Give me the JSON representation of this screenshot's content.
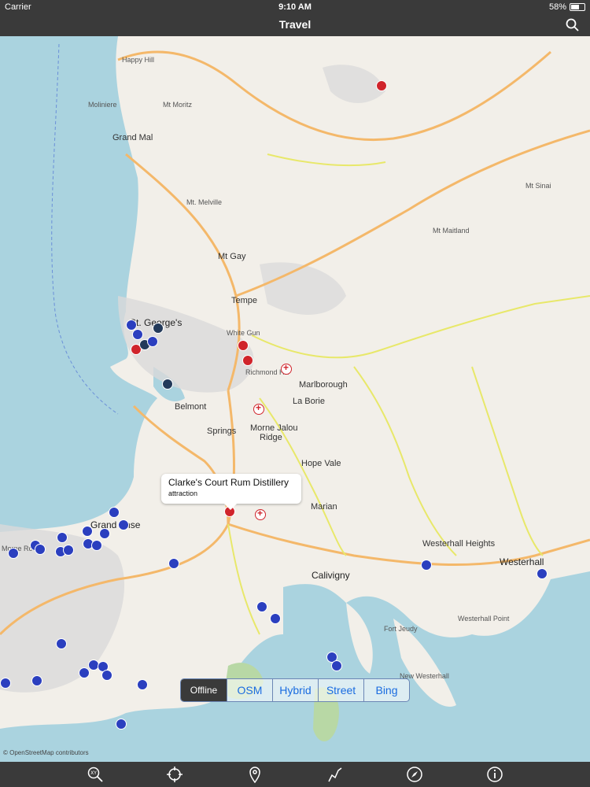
{
  "status_bar": {
    "carrier": "Carrier",
    "time": "9:10 AM",
    "battery": "58%"
  },
  "nav": {
    "title": "Travel"
  },
  "map": {
    "labels": {
      "happy_hill": "Happy Hill",
      "moliniere": "Moliniere",
      "mt_moritz": "Mt Moritz",
      "grand_mal": "Grand Mal",
      "mt_melville": "Mt. Melville",
      "mt_sinai": "Mt Sinai",
      "mt_maitland": "Mt Maitland",
      "mt_gay": "Mt Gay",
      "tempe": "Tempe",
      "st_georges": "St. George's",
      "marlborough": "Marlborough",
      "la_borie": "La Borie",
      "belmont": "Belmont",
      "springs": "Springs",
      "morne_jaloux_ridge_1": "Morne Jalou",
      "morne_jaloux_ridge_2": "Ridge",
      "hope_vale": "Hope Vale",
      "marian": "Marian",
      "grand_anse": "Grand Anse",
      "westerhall_heights": "Westerhall Heights",
      "westerhall": "Westerhall",
      "calivigny": "Calivigny",
      "westerhall_point": "Westerhall Point",
      "fort_jeudy": "Fort Jeudy",
      "new_westerhall": "New Westerhall",
      "morne_rouge": "Morne Rouge",
      "white_gun": "White Gun",
      "richmond_hill": "Richmond Hill"
    },
    "callout": {
      "title": "Clarke's Court Rum Distillery",
      "subtitle": "attraction"
    },
    "attribution": "© OpenStreetMap contributors"
  },
  "map_types": [
    {
      "label": "Offline",
      "active": true
    },
    {
      "label": "OSM",
      "active": false
    },
    {
      "label": "Hybrid",
      "active": false
    },
    {
      "label": "Street",
      "active": false
    },
    {
      "label": "Bing",
      "active": false
    }
  ],
  "tabs": [
    "coordinates-icon",
    "locate-icon",
    "pin-icon",
    "route-icon",
    "compass-icon",
    "info-icon"
  ],
  "colors": {
    "bar": "#3a3a3a",
    "sea": "#aad3df",
    "land": "#f2efe9",
    "road": "#f4b86a",
    "minor_road": "#e8e86a",
    "attraction": "#d0242b",
    "poi": "#2b3fbf"
  }
}
